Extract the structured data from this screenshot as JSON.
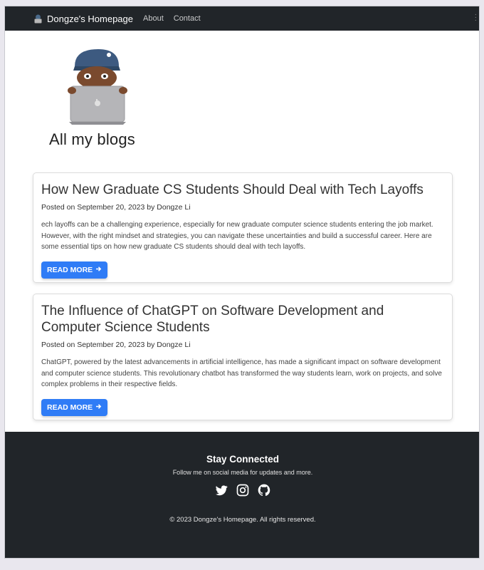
{
  "navbar": {
    "brand": "Dongze's Homepage",
    "links": [
      "About",
      "Contact"
    ]
  },
  "hero": {
    "title": "All my blogs"
  },
  "posts": [
    {
      "title": "How New Graduate CS Students Should Deal with Tech Layoffs",
      "meta": "Posted on September 20, 2023 by Dongze Li",
      "excerpt": "ech layoffs can be a challenging experience, especially for new graduate computer science students entering the job market. However, with the right mindset and strategies, you can navigate these uncertainties and build a successful career. Here are some essential tips on how new graduate CS students should deal with tech layoffs.",
      "button": "READ MORE"
    },
    {
      "title": "The Influence of ChatGPT on Software Development and Computer Science Students",
      "meta": "Posted on September 20, 2023 by Dongze Li",
      "excerpt": "ChatGPT, powered by the latest advancements in artificial intelligence, has made a significant impact on software development and computer science students. This revolutionary chatbot has transformed the way students learn, work on projects, and solve complex problems in their respective fields.",
      "button": "READ MORE"
    }
  ],
  "footer": {
    "title": "Stay Connected",
    "subtitle": "Follow me on social media for updates and more.",
    "social": [
      "twitter-icon",
      "instagram-icon",
      "github-icon"
    ],
    "copyright": "© 2023 Dongze's Homepage. All rights reserved."
  },
  "colors": {
    "navbar_bg": "#212529",
    "accent": "#2f7cf6"
  }
}
